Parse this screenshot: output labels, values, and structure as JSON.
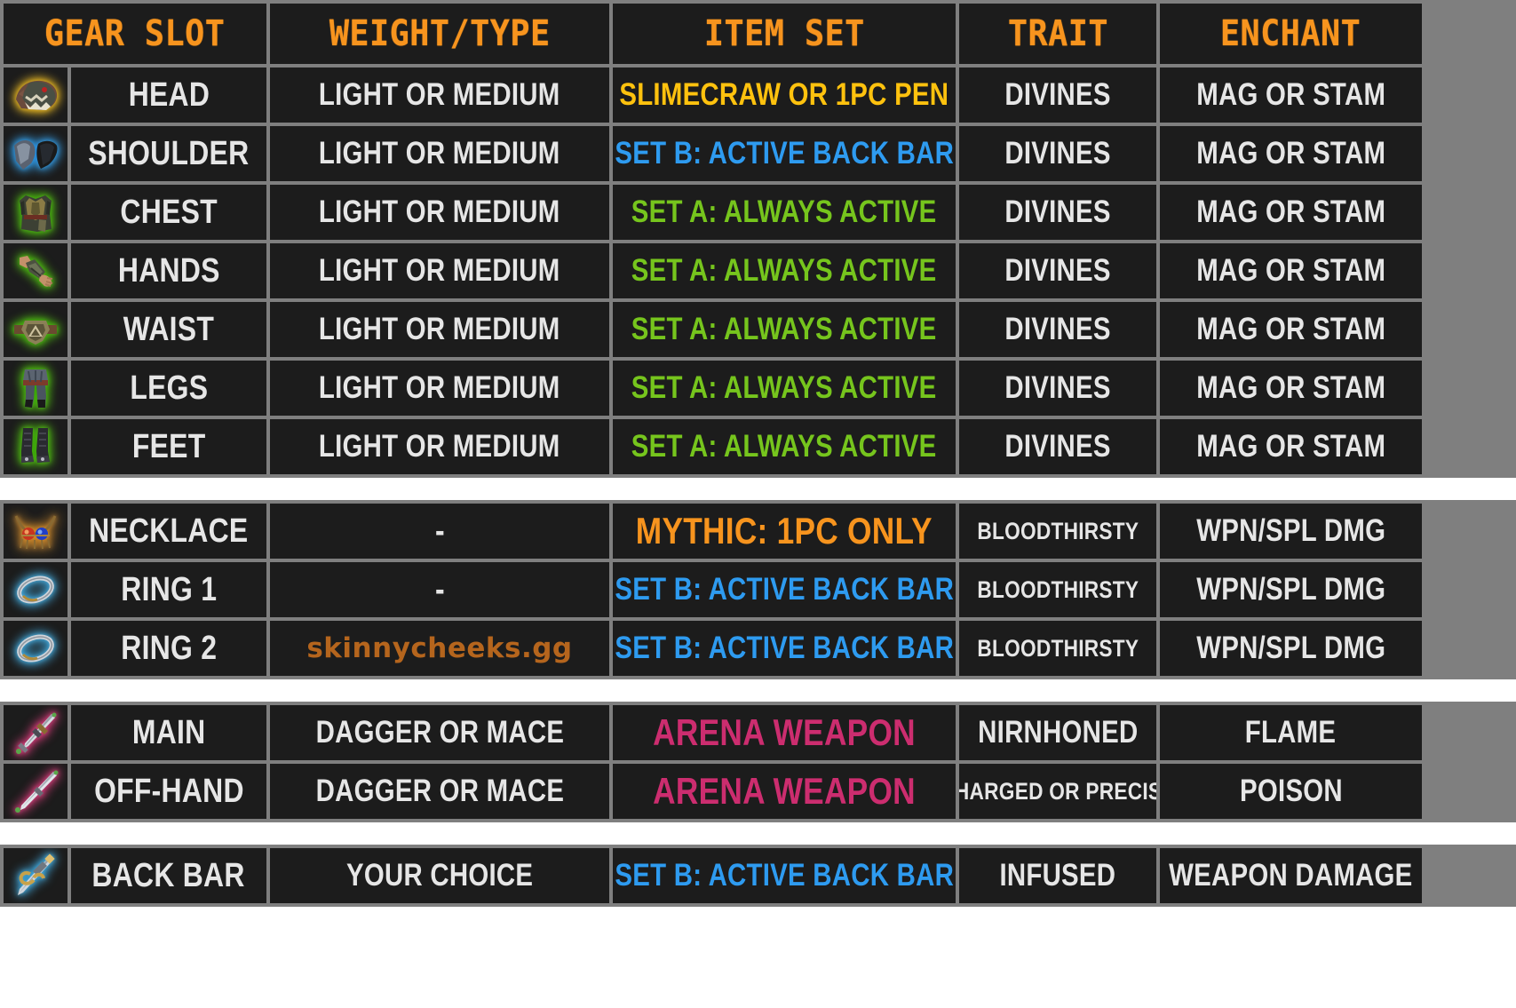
{
  "header": {
    "columns": [
      {
        "label": "GEAR SLOT"
      },
      {
        "label": "WEIGHT/TYPE"
      },
      {
        "label": "ITEM SET"
      },
      {
        "label": "TRAIT"
      },
      {
        "label": "ENCHANT"
      }
    ]
  },
  "colors": {
    "accent_orange": "#f7941e",
    "set_gold": "#ffc20e",
    "set_blue": "#2e9bf0",
    "set_green": "#76c51d",
    "set_pink": "#cc2d6f",
    "text_white": "#e6e6e6",
    "grid_gray": "#7f7f7f",
    "cell_black": "#1c1c1c",
    "watermark_brown": "#b5651d"
  },
  "watermark": "skinnycheeks.gg",
  "sections": [
    {
      "name": "armor",
      "rows": [
        {
          "icon": "monster-helm-icon",
          "glow": "gold",
          "slot": "HEAD",
          "weight": "LIGHT OR MEDIUM",
          "set": "SLIMECRAW OR 1PC PEN",
          "set_color": "col-gold",
          "trait": "DIVINES",
          "enchant": "MAG OR STAM"
        },
        {
          "icon": "shoulder-icon",
          "glow": "blue",
          "slot": "SHOULDER",
          "weight": "LIGHT OR MEDIUM",
          "set": "SET B: ACTIVE BACK BAR",
          "set_color": "col-blue",
          "trait": "DIVINES",
          "enchant": "MAG OR STAM"
        },
        {
          "icon": "chest-icon",
          "glow": "green",
          "slot": "CHEST",
          "weight": "LIGHT OR MEDIUM",
          "set": "SET A: ALWAYS ACTIVE",
          "set_color": "col-green",
          "trait": "DIVINES",
          "enchant": "MAG OR STAM"
        },
        {
          "icon": "gloves-icon",
          "glow": "green",
          "slot": "HANDS",
          "weight": "LIGHT OR MEDIUM",
          "set": "SET A: ALWAYS ACTIVE",
          "set_color": "col-green",
          "trait": "DIVINES",
          "enchant": "MAG OR STAM"
        },
        {
          "icon": "belt-icon",
          "glow": "green",
          "slot": "WAIST",
          "weight": "LIGHT OR MEDIUM",
          "set": "SET A: ALWAYS ACTIVE",
          "set_color": "col-green",
          "trait": "DIVINES",
          "enchant": "MAG OR STAM"
        },
        {
          "icon": "legs-icon",
          "glow": "green",
          "slot": "LEGS",
          "weight": "LIGHT OR MEDIUM",
          "set": "SET A: ALWAYS ACTIVE",
          "set_color": "col-green",
          "trait": "DIVINES",
          "enchant": "MAG OR STAM"
        },
        {
          "icon": "boots-icon",
          "glow": "green",
          "slot": "FEET",
          "weight": "LIGHT OR MEDIUM",
          "set": "SET A: ALWAYS ACTIVE",
          "set_color": "col-green",
          "trait": "DIVINES",
          "enchant": "MAG OR STAM"
        }
      ]
    },
    {
      "name": "jewelry",
      "rows": [
        {
          "icon": "necklace-icon",
          "glow": "orange",
          "slot": "NECKLACE",
          "weight": "-",
          "weight_style": "dash",
          "set": "MYTHIC: 1PC ONLY",
          "set_color": "col-orange",
          "trait": "BLOODTHIRSTY",
          "trait_style": "small",
          "enchant": "WPN/SPL DMG"
        },
        {
          "icon": "ring-icon",
          "glow": "cyan",
          "slot": "RING 1",
          "weight": "-",
          "weight_style": "dash",
          "set": "SET B: ACTIVE BACK BAR",
          "set_color": "col-blue",
          "trait": "BLOODTHIRSTY",
          "trait_style": "small",
          "enchant": "WPN/SPL DMG"
        },
        {
          "icon": "ring-icon",
          "glow": "cyan",
          "slot": "RING 2",
          "weight": "skinnycheeks.gg",
          "weight_style": "watermark",
          "set": "SET B: ACTIVE BACK BAR",
          "set_color": "col-blue",
          "trait": "BLOODTHIRSTY",
          "trait_style": "small",
          "enchant": "WPN/SPL DMG"
        }
      ]
    },
    {
      "name": "weapons-front",
      "rows": [
        {
          "icon": "dagger-icon",
          "glow": "pink",
          "slot": "MAIN",
          "weight": "DAGGER OR MACE",
          "set": "ARENA WEAPON",
          "set_color": "col-pink",
          "trait": "NIRNHONED",
          "enchant": "FLAME"
        },
        {
          "icon": "dagger-alt-icon",
          "glow": "pink",
          "slot": "OFF-HAND",
          "weight": "DAGGER OR MACE",
          "set": "ARENA WEAPON",
          "set_color": "col-pink",
          "trait": "CHARGED OR PRECISE",
          "trait_style": "small",
          "enchant": "POISON"
        }
      ]
    },
    {
      "name": "weapons-back",
      "rows": [
        {
          "icon": "staff-icon",
          "glow": "cyan",
          "slot": "BACK BAR",
          "weight": "YOUR CHOICE",
          "set": "SET B: ACTIVE BACK BAR",
          "set_color": "col-blue",
          "trait": "INFUSED",
          "enchant": "WEAPON DAMAGE"
        }
      ]
    }
  ]
}
